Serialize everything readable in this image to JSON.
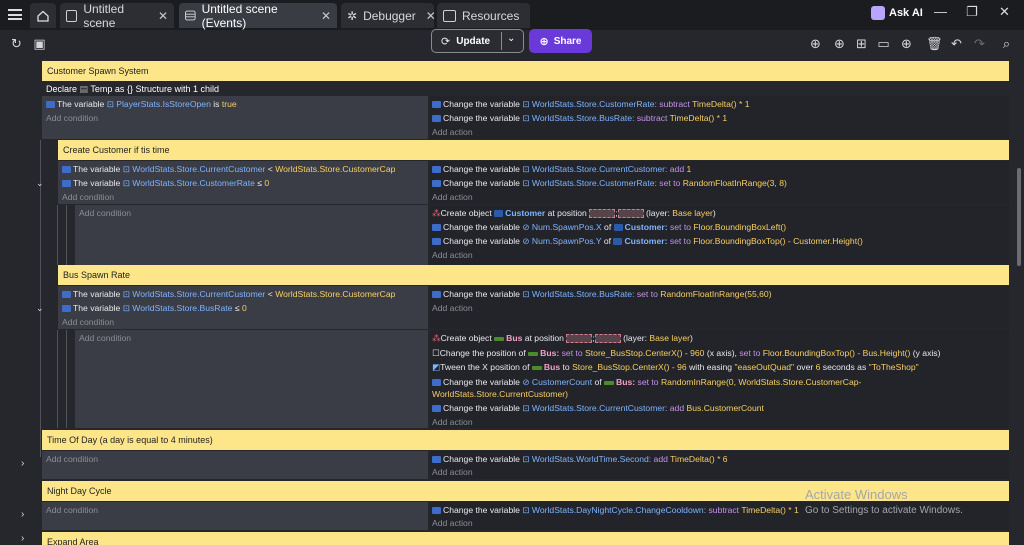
{
  "tabs": [
    {
      "label": "Untitled scene"
    },
    {
      "label": "Untitled scene (Events)"
    },
    {
      "label": "Debugger"
    },
    {
      "label": "Resources"
    }
  ],
  "header": {
    "ask_ai": "Ask AI"
  },
  "toolbar": {
    "update_label": "Update",
    "share_label": "Share"
  },
  "events": {
    "customer_spawn": {
      "comment": "Customer Spawn System",
      "declare": "Declare",
      "declare_var": "Temp",
      "declare_as": "as",
      "declare_type": "{} Structure with 1 child",
      "cond1": {
        "prefix": "The variable",
        "var": "PlayerStats.IsStoreOpen",
        "op": "is",
        "val": "true"
      },
      "add_condition": "Add condition",
      "act1": {
        "prefix": "Change the variable",
        "var": "WorldStats.Store.CustomerRate",
        "op": "subtract",
        "val": "TimeDelta() * 1"
      },
      "act2": {
        "prefix": "Change the variable",
        "var": "WorldStats.Store.BusRate",
        "op": "subtract",
        "val": "TimeDelta() * 1"
      },
      "add_action": "Add action"
    },
    "create_customer": {
      "comment": "Create  Customer if tis time",
      "cond1": {
        "prefix": "The variable",
        "var": "WorldStats.Store.CurrentCustomer",
        "op": "<",
        "val": "WorldStats.Store.CustomerCap"
      },
      "cond2": {
        "prefix": "The variable",
        "var": "WorldStats.Store.CustomerRate",
        "op": "≤",
        "val": "0"
      },
      "act1": {
        "prefix": "Change the variable",
        "var": "WorldStats.Store.CurrentCustomer",
        "op": "add",
        "val": "1"
      },
      "act2": {
        "prefix": "Change the variable",
        "var": "WorldStats.Store.CustomerRate",
        "op": "set to",
        "val": "RandomFloatInRange(3, 8)"
      },
      "sub": {
        "act1": {
          "prefix": "Create object",
          "obj": "Customer",
          "mid": "at position",
          "sep": ";",
          "layer": "(layer:",
          "layer_val": "Base layer",
          "end": ")"
        },
        "act2": {
          "prefix": "Change the variable",
          "var": "Num.SpawnPos.X",
          "of": "of",
          "obj": "Customer:",
          "op": "set to",
          "val": "Floor.BoundingBoxLeft()"
        },
        "act3": {
          "prefix": "Change the variable",
          "var": "Num.SpawnPos.Y",
          "of": "of",
          "obj": "Customer:",
          "op": "set to",
          "val": "Floor.BoundingBoxTop() - Customer.Height()"
        }
      }
    },
    "bus_spawn": {
      "comment": "Bus Spawn Rate",
      "cond1": {
        "prefix": "The variable",
        "var": "WorldStats.Store.CurrentCustomer",
        "op": "<",
        "val": "WorldStats.Store.CustomerCap"
      },
      "cond2": {
        "prefix": "The variable",
        "var": "WorldStats.Store.BusRate",
        "op": "≤",
        "val": "0"
      },
      "act1": {
        "prefix": "Change the variable",
        "var": "WorldStats.Store.BusRate",
        "op": "set to",
        "val": "RandomFloatInRange(55,60)"
      },
      "sub": {
        "act1": {
          "prefix": "Create object",
          "obj": "Bus",
          "mid": "at position",
          "sep": ";",
          "layer": "(layer:",
          "layer_val": "Base layer",
          "end": ")"
        },
        "act2": {
          "prefix": "Change the position of",
          "obj": "Bus:",
          "op1": "set to",
          "val1": "Store_BusStop.CenterX() - 960",
          "mid1": "(x axis),",
          "op2": "set to",
          "val2": "Floor.BoundingBoxTop() - Bus.Height()",
          "end": "(y axis)"
        },
        "act3": {
          "prefix": "Tween the X position of",
          "obj": "Bus",
          "to": "to",
          "val": "Store_BusStop.CenterX() - 96",
          "with": "with easing",
          "ease": "\"easeOutQuad\"",
          "over": "over",
          "secs": "6",
          "secs_as": "seconds as",
          "name": "\"ToTheShop\""
        },
        "act4": {
          "prefix": "Change the variable",
          "var": "CustomerCount",
          "of": "of",
          "obj": "Bus:",
          "op": "set to",
          "val": "RandomInRange(0, WorldStats.Store.CustomerCap-",
          "val2": "WorldStats.Store.CurrentCustomer)"
        },
        "act5": {
          "prefix": "Change the variable",
          "var": "WorldStats.Store.CurrentCustomer",
          "op": "add",
          "val": "Bus.CustomerCount"
        }
      }
    },
    "time_of_day": {
      "comment": "Time Of Day (a day is equal to 4 minutes)",
      "act1": {
        "prefix": "Change the variable",
        "var": "WorldStats.WorldTime.Second",
        "op": "add",
        "val": "TimeDelta() * 6"
      }
    },
    "night_day": {
      "comment": "Night Day Cycle",
      "act1": {
        "prefix": "Change the variable",
        "var": "WorldStats.DayNightCycle.ChangeCooldown",
        "op": "subtract",
        "val": "TimeDelta() * 1"
      }
    },
    "expand_area": {
      "comment": "Expand Area"
    }
  },
  "watermark": {
    "title": "Activate Windows",
    "subtitle": "Go to Settings to activate Windows."
  }
}
